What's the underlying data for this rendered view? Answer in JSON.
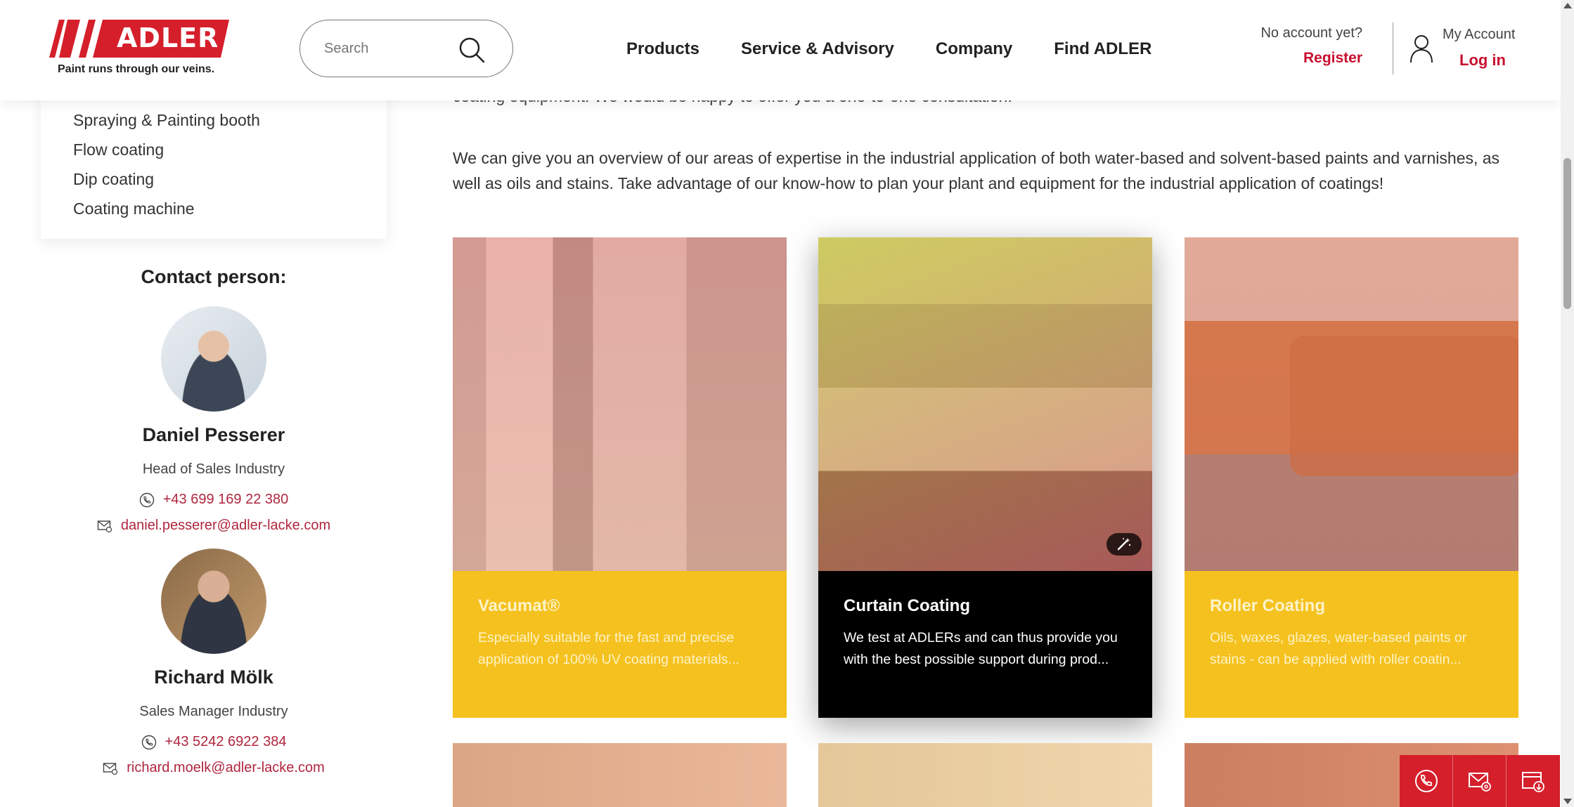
{
  "brand": {
    "logo_text": "ADLER",
    "tagline": "Paint runs through our veins.",
    "red": "#c8102e"
  },
  "search": {
    "placeholder": "Search"
  },
  "nav": {
    "products": "Products",
    "service": "Service & Advisory",
    "company": "Company",
    "find": "Find ADLER"
  },
  "account": {
    "no_account": "No account yet?",
    "register": "Register",
    "my_account": "My Account",
    "login": "Log in"
  },
  "sidebar": {
    "items": [
      {
        "label": "Spraying & Painting booth"
      },
      {
        "label": "Flow coating"
      },
      {
        "label": "Dip coating"
      },
      {
        "label": "Coating machine"
      }
    ],
    "contact_title": "Contact person:",
    "contacts": [
      {
        "name": "Daniel Pesserer",
        "role": "Head of Sales Industry",
        "phone": "+43 699 169 22 380",
        "email": "daniel.pesserer@adler-lacke.com"
      },
      {
        "name": "Richard Mölk",
        "role": "Sales Manager Industry",
        "phone": "+43 5242 6922 384",
        "email": "richard.moelk@adler-lacke.com"
      }
    ]
  },
  "main": {
    "intro_cut": "coating equipment. We would be happy to offer you a one-to-one consultation.",
    "intro": "We can give you an overview of our areas of expertise in the industrial application of both water-based and solvent-based paints and varnishes, as well as oils and stains. Take advantage of our know-how to plan your plant and equipment for the industrial application of coatings!",
    "cards": [
      {
        "title": "Vacumat®",
        "desc": "Especially suitable for the fast and precise application of 100% UV coating materials..."
      },
      {
        "title": "Curtain Coating",
        "desc": "We test at ADLERs and can thus provide you with the best possible support during prod..."
      },
      {
        "title": "Roller Coating",
        "desc": "Oils, waxes, glazes, water-based paints or stains - can be applied with roller coatin..."
      }
    ]
  }
}
